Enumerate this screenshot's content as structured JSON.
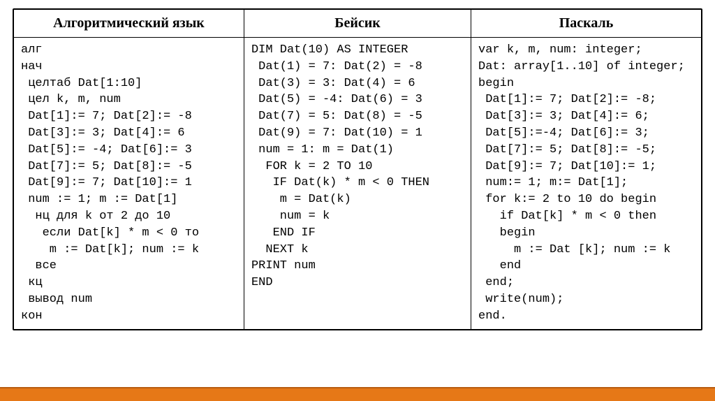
{
  "headers": {
    "col1": "Алгоритмический язык",
    "col2": "Бейсик",
    "col3": "Паскаль"
  },
  "code": {
    "algorithmic": "алг\nнач\n целтаб Dat[1:10]\n цел k, m, num\n Dat[1]:= 7; Dat[2]:= -8\n Dat[3]:= 3; Dat[4]:= 6\n Dat[5]:= -4; Dat[6]:= 3\n Dat[7]:= 5; Dat[8]:= -5\n Dat[9]:= 7; Dat[10]:= 1\n num := 1; m := Dat[1]\n  нц для k от 2 до 10\n   если Dat[k] * m < 0 то\n    m := Dat[k]; num := k\n  все\n кц\n вывод num\nкон",
    "basic": "DIM Dat(10) AS INTEGER\n Dat(1) = 7: Dat(2) = -8\n Dat(3) = 3: Dat(4) = 6\n Dat(5) = -4: Dat(6) = 3\n Dat(7) = 5: Dat(8) = -5\n Dat(9) = 7: Dat(10) = 1\n num = 1: m = Dat(1)\n  FOR k = 2 TO 10\n   IF Dat(k) * m < 0 THEN\n    m = Dat(k)\n    num = k\n   END IF\n  NEXT k\nPRINT num\nEND",
    "pascal": "var k, m, num: integer;\nDat: array[1..10] of integer;\nbegin\n Dat[1]:= 7; Dat[2]:= -8;\n Dat[3]:= 3; Dat[4]:= 6;\n Dat[5]:=-4; Dat[6]:= 3;\n Dat[7]:= 5; Dat[8]:= -5;\n Dat[9]:= 7; Dat[10]:= 1;\n num:= 1; m:= Dat[1];\n for k:= 2 to 10 do begin\n   if Dat[k] * m < 0 then\n   begin\n     m := Dat [k]; num := k\n   end\n end;\n write(num);\nend."
  }
}
